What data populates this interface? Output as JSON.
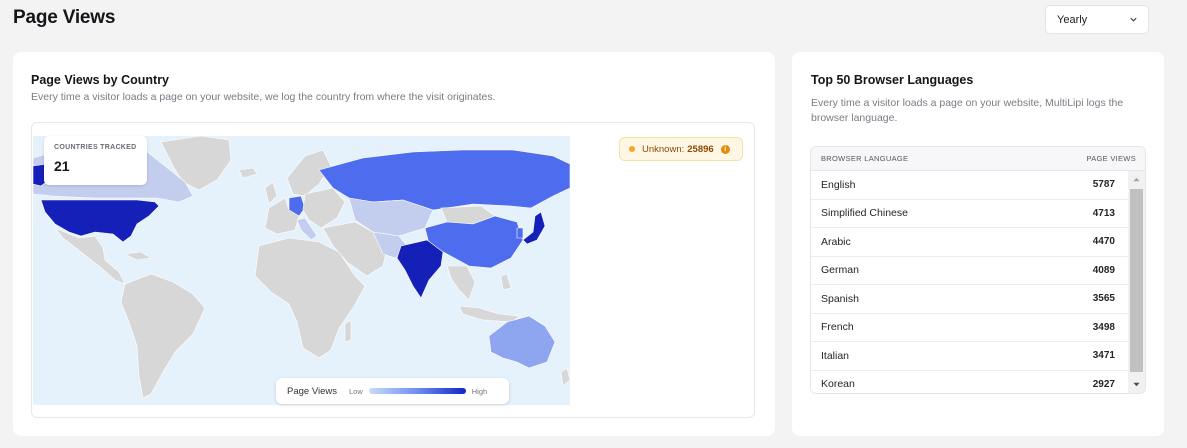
{
  "header": {
    "title": "Page Views",
    "period_select": {
      "value": "Yearly",
      "icon": "chevron-down-icon"
    }
  },
  "country_card": {
    "title": "Page Views by Country",
    "description": "Every time a visitor loads a page on your website, we log the country from where the visit originates.",
    "tracked": {
      "label": "COUNTRIES TRACKED",
      "value": "21"
    },
    "unknown": {
      "label": "Unknown:",
      "value": "25896",
      "icon": "info-icon"
    },
    "legend": {
      "title": "Page Views",
      "low": "Low",
      "high": "High"
    },
    "colors": {
      "ocean": "#e5f1fb",
      "no_data": "#d7d7d7",
      "low": "#c3cdee",
      "mid": "#4d6cee",
      "high": "#1520b8"
    }
  },
  "language_card": {
    "title": "Top 50 Browser Languages",
    "description": "Every time a visitor loads a page on your website, MultiLipi logs the browser language.",
    "columns": [
      "BROWSER LANGUAGE",
      "PAGE VIEWS"
    ],
    "rows": [
      {
        "language": "English",
        "views": "5787"
      },
      {
        "language": "Simplified Chinese",
        "views": "4713"
      },
      {
        "language": "Arabic",
        "views": "4470"
      },
      {
        "language": "German",
        "views": "4089"
      },
      {
        "language": "Spanish",
        "views": "3565"
      },
      {
        "language": "French",
        "views": "3498"
      },
      {
        "language": "Italian",
        "views": "3471"
      },
      {
        "language": "Korean",
        "views": "2927"
      }
    ]
  }
}
